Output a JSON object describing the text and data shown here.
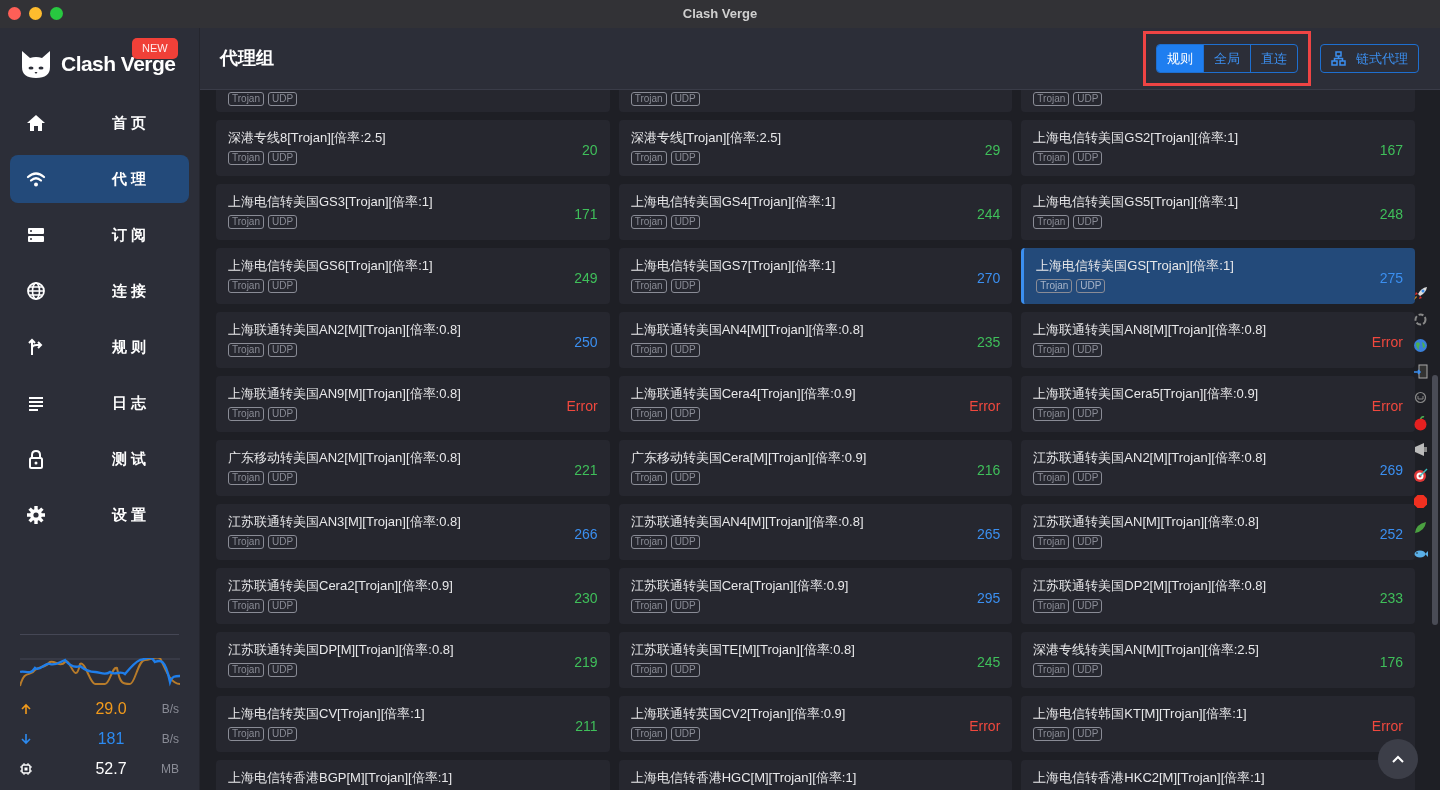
{
  "window": {
    "title": "Clash Verge"
  },
  "logo": {
    "text": "Clash Verge",
    "badge": "NEW"
  },
  "sidebar": {
    "items": [
      {
        "label": "首页",
        "selected": false
      },
      {
        "label": "代理",
        "selected": true
      },
      {
        "label": "订阅",
        "selected": false
      },
      {
        "label": "连接",
        "selected": false
      },
      {
        "label": "规则",
        "selected": false
      },
      {
        "label": "日志",
        "selected": false
      },
      {
        "label": "测试",
        "selected": false
      },
      {
        "label": "设置",
        "selected": false
      }
    ]
  },
  "traffic": {
    "upload": {
      "value": "29.0",
      "unit": "B/s"
    },
    "download": {
      "value": "181",
      "unit": "B/s"
    },
    "memory": {
      "value": "52.7",
      "unit": "MB"
    }
  },
  "header": {
    "title": "代理组",
    "modes": [
      {
        "label": "规则",
        "selected": true
      },
      {
        "label": "全局",
        "selected": false
      },
      {
        "label": "直连",
        "selected": false
      }
    ],
    "mode_highlighted": true,
    "chain_button": "链式代理"
  },
  "proxies": [
    {
      "tags": [
        "Trojan",
        "UDP"
      ],
      "selected": false
    },
    {
      "tags": [
        "Trojan",
        "UDP"
      ],
      "selected": false
    },
    {
      "tags": [
        "Trojan",
        "UDP"
      ],
      "selected": false
    },
    {
      "name": "深港专线8[Trojan][倍率:2.5]",
      "tags": [
        "Trojan",
        "UDP"
      ],
      "delay": "20",
      "color": "#3fbf5a",
      "selected": false
    },
    {
      "name": "深港专线[Trojan][倍率:2.5]",
      "tags": [
        "Trojan",
        "UDP"
      ],
      "delay": "29",
      "color": "#3fbf5a",
      "selected": false
    },
    {
      "name": "上海电信转美国GS2[Trojan][倍率:1]",
      "tags": [
        "Trojan",
        "UDP"
      ],
      "delay": "167",
      "color": "#3fbf5a",
      "selected": false
    },
    {
      "name": "上海电信转美国GS3[Trojan][倍率:1]",
      "tags": [
        "Trojan",
        "UDP"
      ],
      "delay": "171",
      "color": "#3fbf5a",
      "selected": false
    },
    {
      "name": "上海电信转美国GS4[Trojan][倍率:1]",
      "tags": [
        "Trojan",
        "UDP"
      ],
      "delay": "244",
      "color": "#3fbf5a",
      "selected": false
    },
    {
      "name": "上海电信转美国GS5[Trojan][倍率:1]",
      "tags": [
        "Trojan",
        "UDP"
      ],
      "delay": "248",
      "color": "#3fbf5a",
      "selected": false
    },
    {
      "name": "上海电信转美国GS6[Trojan][倍率:1]",
      "tags": [
        "Trojan",
        "UDP"
      ],
      "delay": "249",
      "color": "#3fbf5a",
      "selected": false
    },
    {
      "name": "上海电信转美国GS7[Trojan][倍率:1]",
      "tags": [
        "Trojan",
        "UDP"
      ],
      "delay": "270",
      "color": "#3b8ff0",
      "selected": false
    },
    {
      "name": "上海电信转美国GS[Trojan][倍率:1]",
      "tags": [
        "Trojan",
        "UDP"
      ],
      "delay": "275",
      "color": "#3b8ff0",
      "selected": true
    },
    {
      "name": "上海联通转美国AN2[M][Trojan][倍率:0.8]",
      "tags": [
        "Trojan",
        "UDP"
      ],
      "delay": "250",
      "color": "#3b8ff0",
      "selected": false
    },
    {
      "name": "上海联通转美国AN4[M][Trojan][倍率:0.8]",
      "tags": [
        "Trojan",
        "UDP"
      ],
      "delay": "235",
      "color": "#3fbf5a",
      "selected": false
    },
    {
      "name": "上海联通转美国AN8[M][Trojan][倍率:0.8]",
      "tags": [
        "Trojan",
        "UDP"
      ],
      "delay": "Error",
      "color": "#f0483e",
      "selected": false
    },
    {
      "name": "上海联通转美国AN9[M][Trojan][倍率:0.8]",
      "tags": [
        "Trojan",
        "UDP"
      ],
      "delay": "Error",
      "color": "#f0483e",
      "selected": false
    },
    {
      "name": "上海联通转美国Cera4[Trojan][倍率:0.9]",
      "tags": [
        "Trojan",
        "UDP"
      ],
      "delay": "Error",
      "color": "#f0483e",
      "selected": false
    },
    {
      "name": "上海联通转美国Cera5[Trojan][倍率:0.9]",
      "tags": [
        "Trojan",
        "UDP"
      ],
      "delay": "Error",
      "color": "#f0483e",
      "selected": false
    },
    {
      "name": "广东移动转美国AN2[M][Trojan][倍率:0.8]",
      "tags": [
        "Trojan",
        "UDP"
      ],
      "delay": "221",
      "color": "#3fbf5a",
      "selected": false
    },
    {
      "name": "广东移动转美国Cera[M][Trojan][倍率:0.9]",
      "tags": [
        "Trojan",
        "UDP"
      ],
      "delay": "216",
      "color": "#3fbf5a",
      "selected": false
    },
    {
      "name": "江苏联通转美国AN2[M][Trojan][倍率:0.8]",
      "tags": [
        "Trojan",
        "UDP"
      ],
      "delay": "269",
      "color": "#3b8ff0",
      "selected": false
    },
    {
      "name": "江苏联通转美国AN3[M][Trojan][倍率:0.8]",
      "tags": [
        "Trojan",
        "UDP"
      ],
      "delay": "266",
      "color": "#3b8ff0",
      "selected": false
    },
    {
      "name": "江苏联通转美国AN4[M][Trojan][倍率:0.8]",
      "tags": [
        "Trojan",
        "UDP"
      ],
      "delay": "265",
      "color": "#3b8ff0",
      "selected": false
    },
    {
      "name": "江苏联通转美国AN[M][Trojan][倍率:0.8]",
      "tags": [
        "Trojan",
        "UDP"
      ],
      "delay": "252",
      "color": "#3b8ff0",
      "selected": false
    },
    {
      "name": "江苏联通转美国Cera2[Trojan][倍率:0.9]",
      "tags": [
        "Trojan",
        "UDP"
      ],
      "delay": "230",
      "color": "#3fbf5a",
      "selected": false
    },
    {
      "name": "江苏联通转美国Cera[Trojan][倍率:0.9]",
      "tags": [
        "Trojan",
        "UDP"
      ],
      "delay": "295",
      "color": "#3b8ff0",
      "selected": false
    },
    {
      "name": "江苏联通转美国DP2[M][Trojan][倍率:0.8]",
      "tags": [
        "Trojan",
        "UDP"
      ],
      "delay": "233",
      "color": "#3fbf5a",
      "selected": false
    },
    {
      "name": "江苏联通转美国DP[M][Trojan][倍率:0.8]",
      "tags": [
        "Trojan",
        "UDP"
      ],
      "delay": "219",
      "color": "#3fbf5a",
      "selected": false
    },
    {
      "name": "江苏联通转美国TE[M][Trojan][倍率:0.8]",
      "tags": [
        "Trojan",
        "UDP"
      ],
      "delay": "245",
      "color": "#3fbf5a",
      "selected": false
    },
    {
      "name": "深港专线转美国AN[M][Trojan][倍率:2.5]",
      "tags": [
        "Trojan",
        "UDP"
      ],
      "delay": "176",
      "color": "#3fbf5a",
      "selected": false
    },
    {
      "name": "上海电信转英国CV[Trojan][倍率:1]",
      "tags": [
        "Trojan",
        "UDP"
      ],
      "delay": "211",
      "color": "#3fbf5a",
      "selected": false
    },
    {
      "name": "上海联通转英国CV2[Trojan][倍率:0.9]",
      "tags": [
        "Trojan",
        "UDP"
      ],
      "delay": "Error",
      "color": "#f0483e",
      "selected": false
    },
    {
      "name": "上海电信转韩国KT[M][Trojan][倍率:1]",
      "tags": [
        "Trojan",
        "UDP"
      ],
      "delay": "Error",
      "color": "#f0483e",
      "selected": false
    },
    {
      "name": "上海电信转香港BGP[M][Trojan][倍率:1]",
      "selected": false
    },
    {
      "name": "上海电信转香港HGC[M][Trojan][倍率:1]",
      "selected": false
    },
    {
      "name": "上海电信转香港HKC2[M][Trojan][倍率:1]",
      "selected": false
    }
  ]
}
